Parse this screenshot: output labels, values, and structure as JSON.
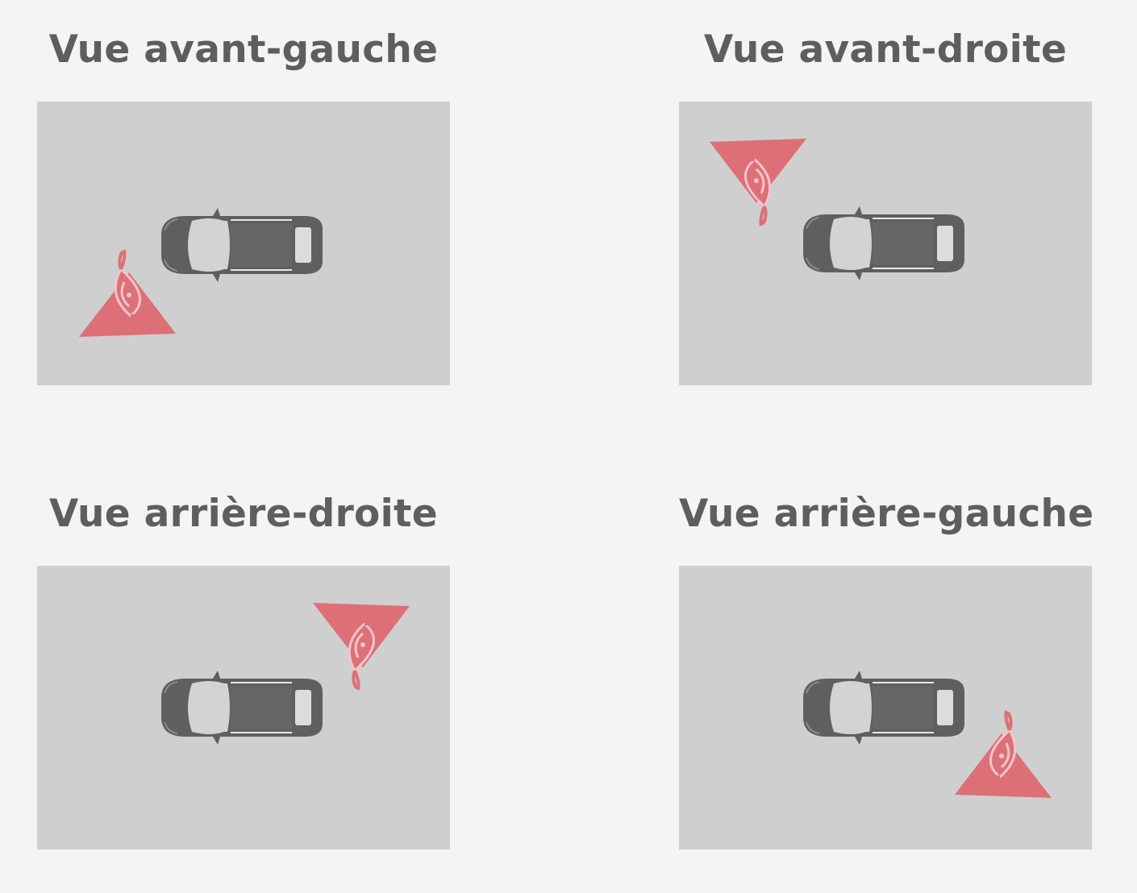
{
  "views": [
    {
      "title": "Vue avant-gauche"
    },
    {
      "title": "Vue avant-droite"
    },
    {
      "title": "Vue arrière-droite"
    },
    {
      "title": "Vue arrière-gauche"
    }
  ],
  "colors": {
    "background": "#f4f4f4",
    "panel": "#cfcfcf",
    "car": "#5f5f5f",
    "eye": "#dd7077",
    "title": "#5e5e5e"
  },
  "icons": {
    "car": "car-top-view-icon",
    "viewer": "eye-view-cone-icon"
  }
}
